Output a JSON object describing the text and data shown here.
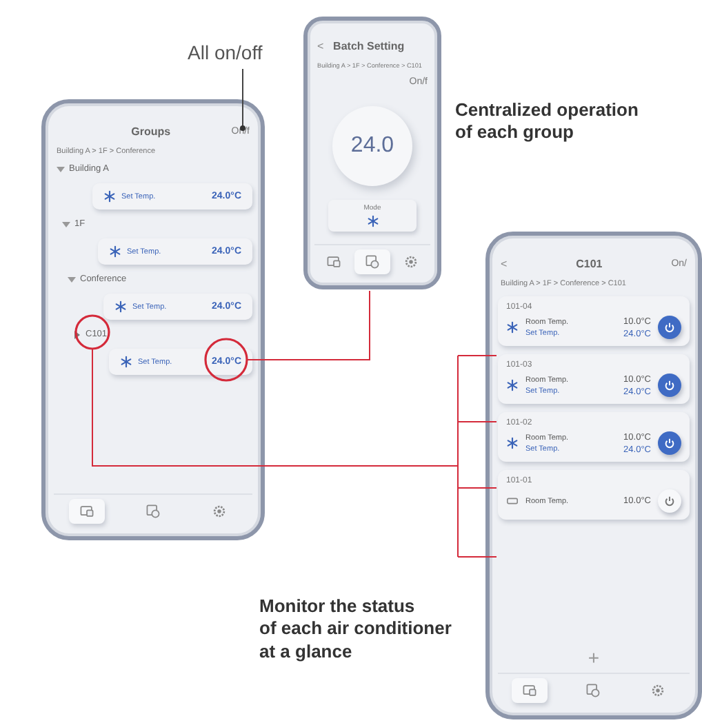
{
  "callouts": {
    "all_on_off": "All on/off",
    "centralized": "Centralized operation\nof each group",
    "monitor": "Monitor the status\nof each air conditioner\nat a glance"
  },
  "groups_screen": {
    "title": "Groups",
    "all_button": "On/f",
    "breadcrumb": "Building A > 1F > Conference",
    "tree": [
      {
        "label": "Building A",
        "expanded": true,
        "summary": {
          "label": "Set Temp.",
          "value": "24.0°C"
        },
        "children": [
          {
            "label": "1F",
            "expanded": true,
            "summary": {
              "label": "Set Temp.",
              "value": "24.0°C"
            },
            "children": [
              {
                "label": "Conference",
                "expanded": true,
                "summary": {
                  "label": "Set Temp.",
                  "value": "24.0°C"
                },
                "children": [
                  {
                    "label": "C101",
                    "expanded": false,
                    "summary": {
                      "label": "Set Temp.",
                      "value": "24.0°C"
                    }
                  }
                ]
              }
            ]
          }
        ]
      }
    ],
    "tabs": [
      {
        "kind": "rooms",
        "selected": true
      },
      {
        "kind": "schedule",
        "selected": false
      },
      {
        "kind": "settings",
        "selected": false
      }
    ]
  },
  "batch_screen": {
    "back": "<",
    "title": "Batch Setting",
    "breadcrumb": "Building A > 1F > Conference > C101",
    "all_button": "On/f",
    "temperature": "24.0",
    "mode_label": "Mode",
    "tabs": [
      {
        "kind": "rooms",
        "selected": false
      },
      {
        "kind": "schedule",
        "selected": true
      },
      {
        "kind": "settings",
        "selected": false
      }
    ]
  },
  "room_screen": {
    "back": "<",
    "title": "C101",
    "all_button": "On/",
    "breadcrumb": "Building A > 1F > Conference > C101",
    "units": [
      {
        "name": "101-04",
        "on": true,
        "room_label": "Room Temp.",
        "room_value": "10.0°C",
        "set_label": "Set Temp.",
        "set_value": "24.0°C"
      },
      {
        "name": "101-03",
        "on": true,
        "room_label": "Room Temp.",
        "room_value": "10.0°C",
        "set_label": "Set Temp.",
        "set_value": "24.0°C"
      },
      {
        "name": "101-02",
        "on": true,
        "room_label": "Room Temp.",
        "room_value": "10.0°C",
        "set_label": "Set Temp.",
        "set_value": "24.0°C"
      },
      {
        "name": "101-01",
        "on": false,
        "room_label": "Room Temp.",
        "room_value": "10.0°C"
      }
    ],
    "add": "+",
    "tabs": [
      {
        "kind": "rooms",
        "selected": true
      },
      {
        "kind": "schedule",
        "selected": false
      },
      {
        "kind": "settings",
        "selected": false
      }
    ]
  }
}
